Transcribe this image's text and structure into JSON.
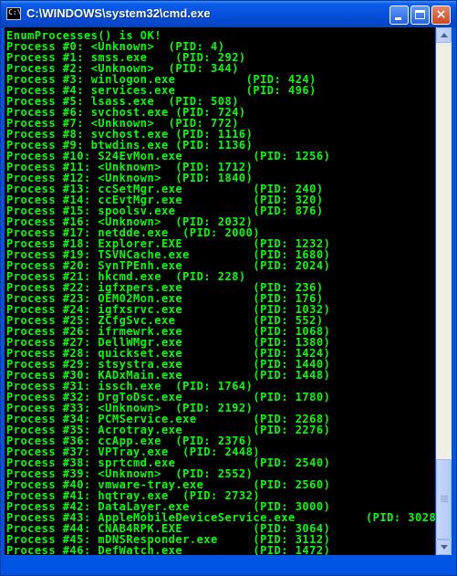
{
  "window": {
    "title": "C:\\WINDOWS\\system32\\cmd.exe",
    "icon_text": "C:\\",
    "buttons": [
      "minimize-icon",
      "maximize-icon",
      "close-icon"
    ],
    "close_glyph": "×"
  },
  "console": {
    "text_color": "#00ff00",
    "background": "#000000",
    "lines": [
      "EnumProcesses() is OK!",
      "Process #0: <Unknown>  (PID: 4)",
      "Process #1: smss.exe    (PID: 292)",
      "Process #2: <Unknown>  (PID: 344)",
      "Process #3: winlogon.exe          (PID: 424)",
      "Process #4: services.exe          (PID: 496)",
      "Process #5: lsass.exe  (PID: 508)",
      "Process #6: svchost.exe (PID: 724)",
      "Process #7: <Unknown>  (PID: 772)",
      "Process #8: svchost.exe (PID: 1116)",
      "Process #9: btwdins.exe (PID: 1136)",
      "Process #10: S24EvMon.exe          (PID: 1256)",
      "Process #11: <Unknown>  (PID: 1712)",
      "Process #12: <Unknown>  (PID: 1840)",
      "Process #13: ccSetMgr.exe          (PID: 240)",
      "Process #14: ccEvtMgr.exe          (PID: 320)",
      "Process #15: spoolsv.exe           (PID: 876)",
      "Process #16: <Unknown>  (PID: 2032)",
      "Process #17: netdde.exe  (PID: 2000)",
      "Process #18: Explorer.EXE          (PID: 1232)",
      "Process #19: TSVNCache.exe         (PID: 1680)",
      "Process #20: SynTPEnh.exe          (PID: 2024)",
      "Process #21: hkcmd.exe  (PID: 228)",
      "Process #22: igfxpers.exe          (PID: 236)",
      "Process #23: OEM02Mon.exe          (PID: 176)",
      "Process #24: igfxsrvc.exe          (PID: 1032)",
      "Process #25: ZCfgSvc.exe           (PID: 552)",
      "Process #26: ifrmewrk.exe          (PID: 1068)",
      "Process #27: DellWMgr.exe          (PID: 1380)",
      "Process #28: quickset.exe          (PID: 1424)",
      "Process #29: stsystra.exe          (PID: 1440)",
      "Process #30: KADxMain.exe          (PID: 1448)",
      "Process #31: issch.exe  (PID: 1764)",
      "Process #32: DrgToDsc.exe          (PID: 1780)",
      "Process #33: <Unknown>  (PID: 2192)",
      "Process #34: PCMService.exe        (PID: 2268)",
      "Process #35: Acrotray.exe          (PID: 2276)",
      "Process #36: ccApp.exe  (PID: 2376)",
      "Process #37: VPTray.exe  (PID: 2448)",
      "Process #38: sprtcmd.exe           (PID: 2540)",
      "Process #39: <Unknown>  (PID: 2552)",
      "Process #40: vmware-tray.exe       (PID: 2560)",
      "Process #41: hqtray.exe  (PID: 2732)",
      "Process #42: DataLayer.exe         (PID: 3000)",
      "Process #43: AppleMobileDeviceService.exe          (PID: 3028)",
      "Process #44: CNAB4RPK.EXE          (PID: 3064)",
      "Process #45: mDNSResponder.exe     (PID: 3112)",
      "Process #46: DefWatch.exe          (PID: 1472)"
    ]
  },
  "scrollbar": {
    "up_icon": "scroll-up-arrow-icon",
    "down_icon": "scroll-down-arrow-icon",
    "position": 0.85
  }
}
